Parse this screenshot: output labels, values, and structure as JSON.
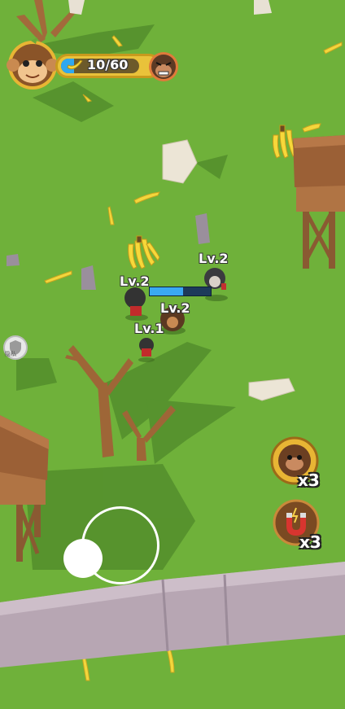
{
  "hud": {
    "banana_progress_text": "10/60",
    "banana_progress_fraction": 0.17,
    "player_avatar_icon": "monkey-face-icon",
    "boss_avatar_icon": "gorilla-face-icon",
    "banana_icon": "banana-icon"
  },
  "level_labels": {
    "player": "Lv.2",
    "enemy_right": "Lv.2",
    "enemy_center": "Lv.2",
    "enemy_small": "Lv.1"
  },
  "enemy_health_fraction": 0.55,
  "boosters": {
    "gorilla_count": "x3",
    "magnet_count": "x3",
    "gorilla_icon": "gorilla-boost-icon",
    "magnet_icon": "magnet-icon"
  },
  "privacy": {
    "label": "隐私",
    "icon": "shield-icon"
  },
  "colors": {
    "grass": "#6fb13a",
    "hud_gold": "#e9c23a",
    "progress_blue": "#2fa8f0",
    "wall": "#b7a6b3"
  }
}
